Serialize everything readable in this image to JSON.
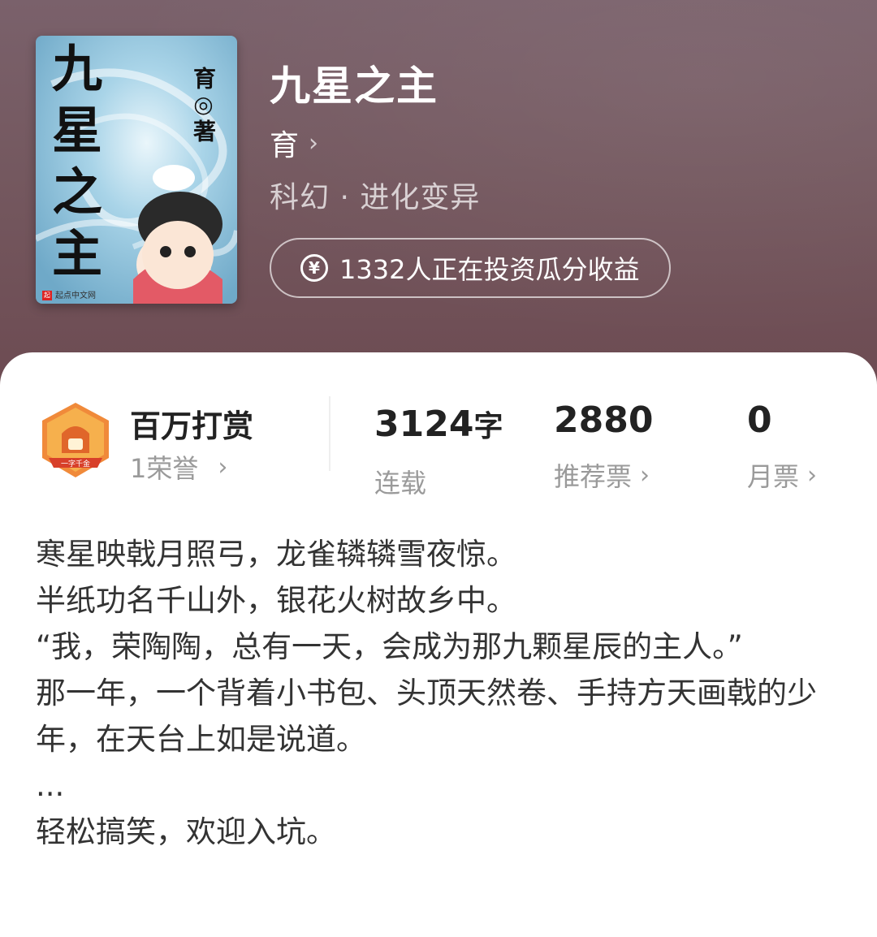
{
  "cover": {
    "title_chars": [
      "九",
      "星",
      "之",
      "主"
    ],
    "author_mark": "育◎著",
    "publisher": "起点中文网"
  },
  "book": {
    "title": "九星之主",
    "author": "育",
    "genre": "科幻 · 进化变异",
    "invest_text": "1332人正在投资瓜分收益"
  },
  "honor": {
    "title": "百万打赏",
    "subtitle": "1荣誉",
    "badge_text": "一字千金"
  },
  "stats": [
    {
      "value": "3124",
      "unit": "字",
      "label": "连载"
    },
    {
      "value": "2880",
      "unit": "",
      "label": "推荐票"
    },
    {
      "value": "0",
      "unit": "",
      "label": "月票"
    }
  ],
  "description": [
    "寒星映戟月照弓，龙雀辚辚雪夜惊。",
    "半纸功名千山外，银花火树故乡中。",
    "“我，荣陶陶，总有一天，会成为那九颗星辰的主人。”",
    "那一年，一个背着小书包、头顶天然卷、手持方天画戟的少年，在天台上如是说道。",
    "...",
    "轻松搞笑，欢迎入坑。"
  ],
  "icons": {
    "chevron": "chevron-right-icon",
    "yen": "yen-coin-icon"
  },
  "colors": {
    "header_bg": "#74585f",
    "accent_badge": "#e8632a"
  }
}
